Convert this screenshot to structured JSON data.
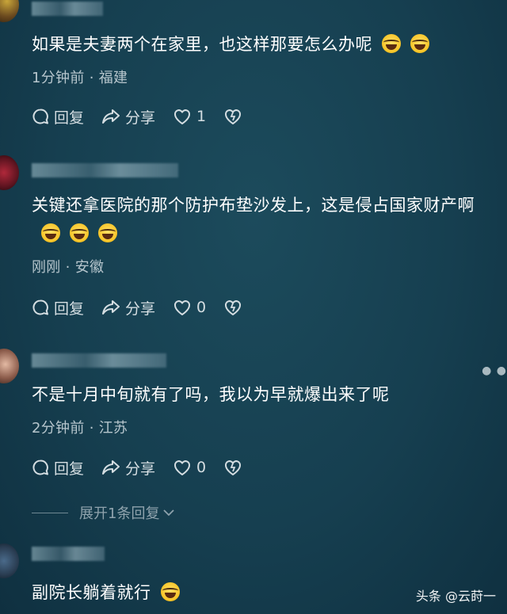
{
  "comments": [
    {
      "text": "如果是夫妻两个在家里，也这样那要怎么办呢",
      "emoji_count": 2,
      "time": "1分钟前",
      "location": "福建",
      "reply_label": "回复",
      "share_label": "分享",
      "likes": "1"
    },
    {
      "text": "关键还拿医院的那个防护布垫沙发上，这是侵占国家财产啊",
      "emoji_count": 3,
      "time": "刚刚",
      "location": "安徽",
      "reply_label": "回复",
      "share_label": "分享",
      "likes": "0"
    },
    {
      "text": "不是十月中旬就有了吗，我以为早就爆出来了呢",
      "emoji_count": 0,
      "time": "2分钟前",
      "location": "江苏",
      "reply_label": "回复",
      "share_label": "分享",
      "likes": "0"
    },
    {
      "text": "副院长躺着就行",
      "emoji_count": 1
    }
  ],
  "meta_separator": "·",
  "expand_replies": "展开1条回复",
  "watermark": "头条 @云莳一",
  "colors": {
    "background": "#143f50",
    "text": "#ffffff",
    "meta": "#b7c6cd"
  }
}
